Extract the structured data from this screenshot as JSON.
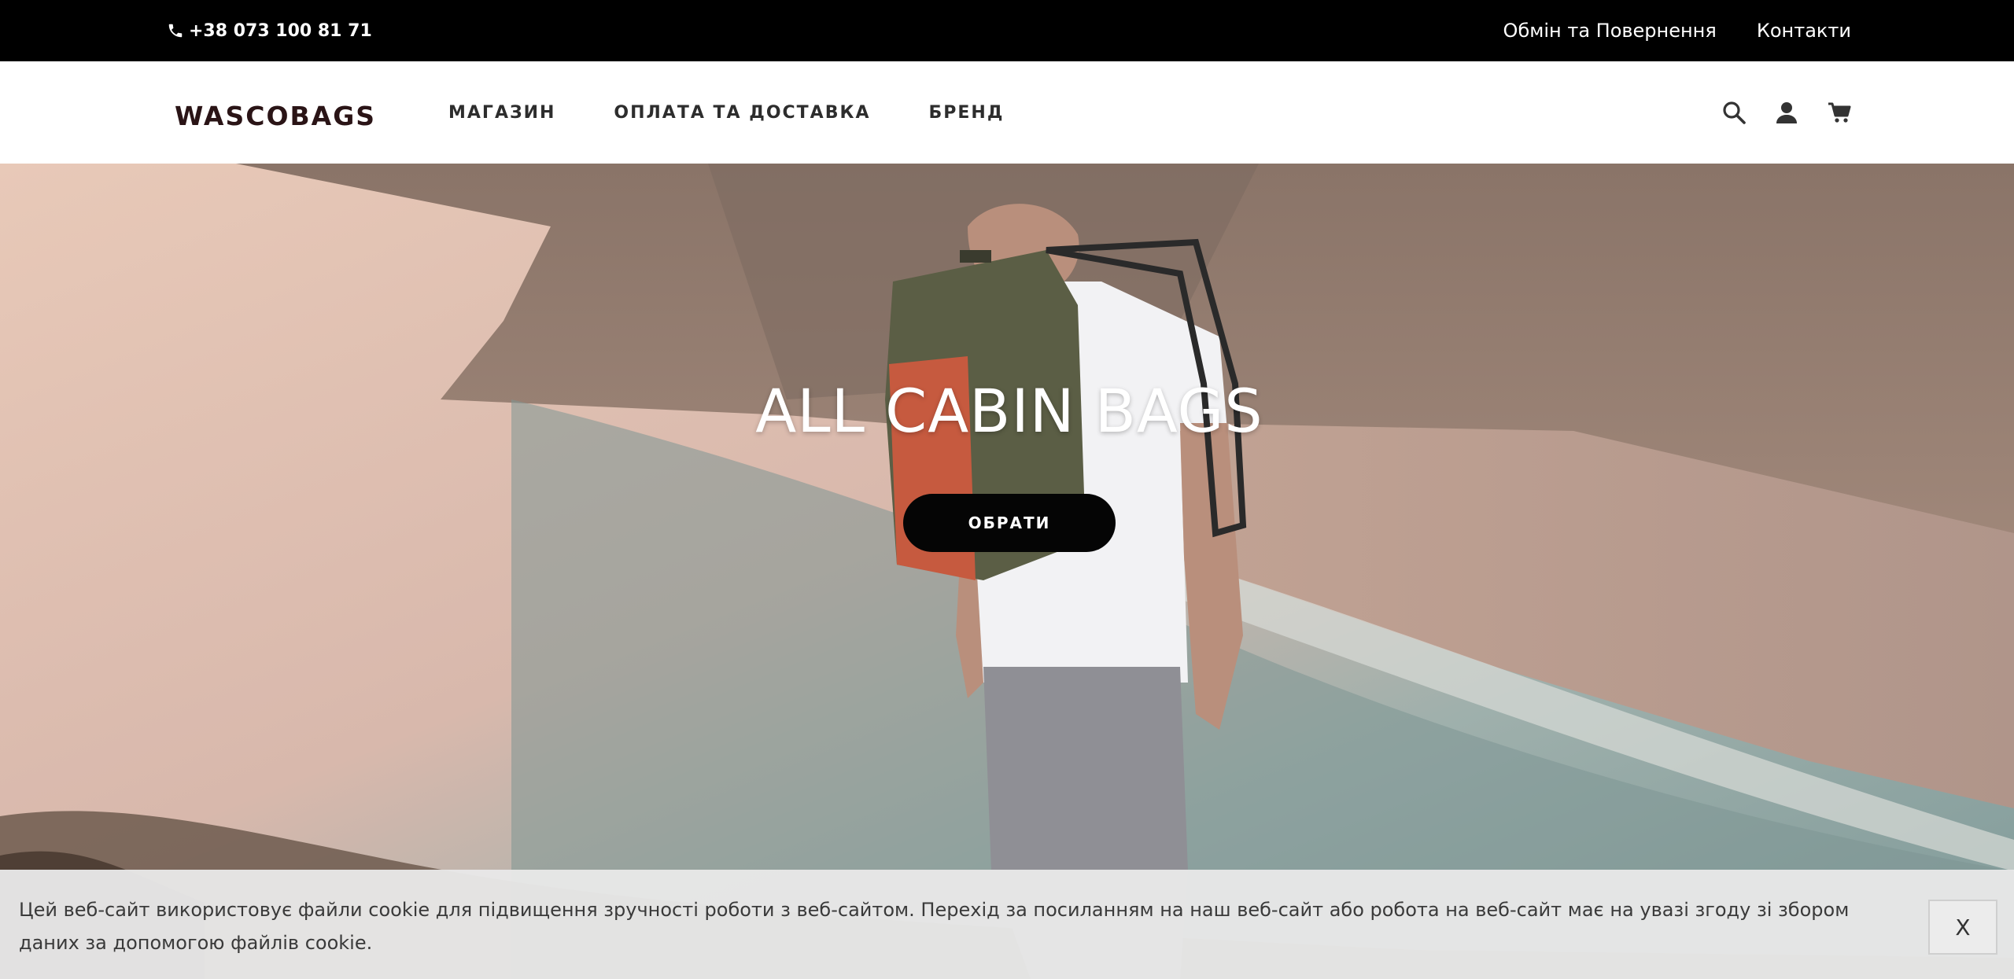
{
  "topbar": {
    "phone": "+38 073 100 81 71",
    "links": [
      "Обмін та Повернення",
      "Контакти"
    ]
  },
  "header": {
    "logo": "WASCOBAGS",
    "nav": [
      "МАГАЗИН",
      "ОПЛАТА ТА ДОСТАВКА",
      "БРЕНД"
    ],
    "icons": [
      "search-icon",
      "user-icon",
      "cart-icon"
    ]
  },
  "hero": {
    "title": "ALL CABIN BAGS",
    "button": "ОБРАТИ"
  },
  "cookie": {
    "text": "Цей веб-сайт використовує файли cookie для підвищення зручності роботи з веб-сайтом. Перехід за посиланням на наш веб-сайт або робота на веб-сайт має на увазі згоду зі збором даних за допомогою файлів cookie.",
    "close": "X"
  },
  "colors": {
    "topbar_bg": "#000000",
    "text_dark": "#2d2d2d",
    "button_bg": "#050505",
    "cookie_bg": "#e8e8e8"
  }
}
